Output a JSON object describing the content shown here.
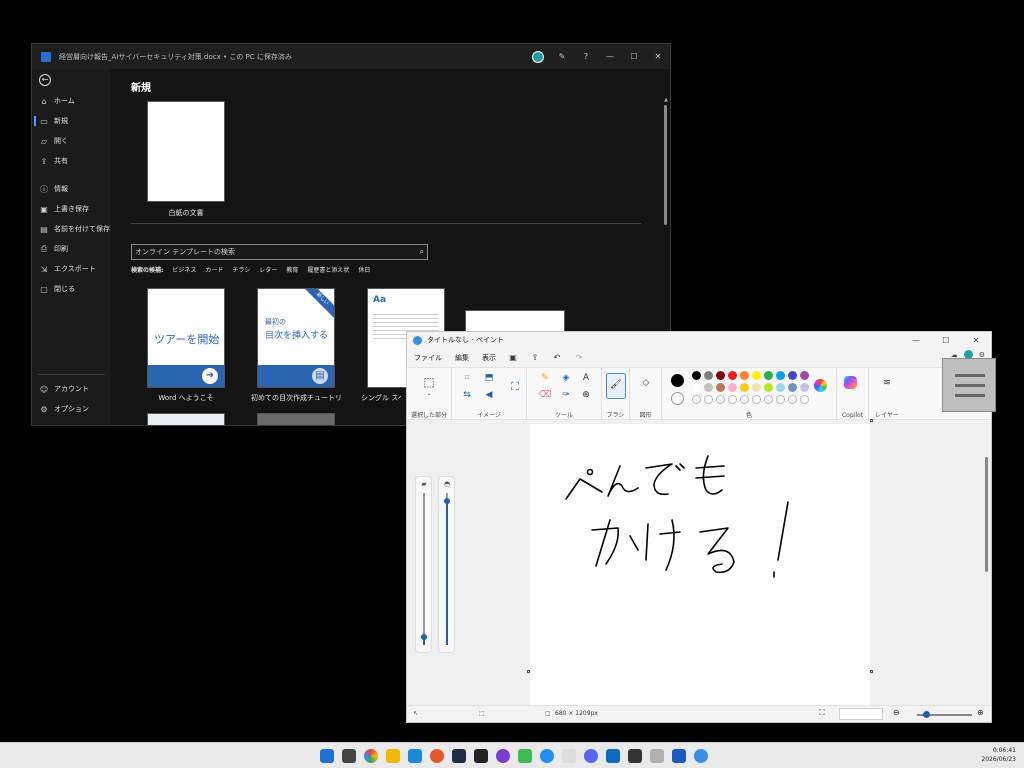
{
  "word": {
    "title": "経営層向け報告_AIサイバーセキュリティ対策.docx • この PC に保存済み",
    "sidebar": {
      "items": [
        {
          "label": "ホーム",
          "icon": "home-icon"
        },
        {
          "label": "新規",
          "icon": "new-doc-icon"
        },
        {
          "label": "開く",
          "icon": "folder-open-icon"
        },
        {
          "label": "共有",
          "icon": "share-icon"
        },
        {
          "label": "情報",
          "icon": "info-icon"
        },
        {
          "label": "上書き保存",
          "icon": "save-icon"
        },
        {
          "label": "名前を付けて保存",
          "icon": "save-as-icon"
        },
        {
          "label": "印刷",
          "icon": "print-icon"
        },
        {
          "label": "エクスポート",
          "icon": "export-icon"
        },
        {
          "label": "閉じる",
          "icon": "close-folder-icon"
        }
      ],
      "bottom": [
        {
          "label": "アカウント",
          "icon": "account-icon"
        },
        {
          "label": "オプション",
          "icon": "options-icon"
        }
      ],
      "active_index": 1
    },
    "main": {
      "heading": "新規",
      "blank_label": "白紙の文書",
      "search_placeholder": "オンライン テンプレートの検索",
      "suggestions_label": "検索の候補:",
      "suggestions": [
        "ビジネス",
        "カード",
        "チラシ",
        "レター",
        "教育",
        "履歴書と添え状",
        "休日"
      ],
      "templates": [
        {
          "label": "Word へようこそ",
          "card_text": "ツアーを開始"
        },
        {
          "label": "初めての目次作成チュートリ...",
          "card_line1": "最初の",
          "card_line2": "目次を挿入する",
          "ribbon": "新しい"
        },
        {
          "label": "シングル スペー",
          "card_text": "Aa"
        }
      ]
    }
  },
  "paint": {
    "title": "タイトルなし - ペイント",
    "menu": [
      "ファイル",
      "編集",
      "表示"
    ],
    "groups": {
      "selection": "選択した部分",
      "image": "イメージ",
      "tools": "ツール",
      "brush": "ブラシ",
      "shapes": "図形",
      "colors": "色",
      "copilot": "Copilot",
      "layers": "レイヤー"
    },
    "palette_row1": [
      "#000000",
      "#7f7f7f",
      "#880015",
      "#ed1c24",
      "#ff7f27",
      "#fff200",
      "#22b14c",
      "#00a2e8",
      "#3f48cc",
      "#a349a4"
    ],
    "palette_row2": [
      "#ffffff",
      "#c3c3c3",
      "#b97a57",
      "#ffaec9",
      "#ffc90e",
      "#efe4b0",
      "#b5e61d",
      "#99d9ea",
      "#7092be",
      "#c8bfe7"
    ],
    "primary_color": "#000000",
    "canvas_text": "ぺんでも かける!",
    "status_size": "680 × 1209px",
    "zoom_level": 0.1,
    "brush_size_level": 0.05,
    "opacity_level": 0.95
  },
  "taskbar": {
    "time": "0:06:41",
    "date": "2026/06/23"
  }
}
